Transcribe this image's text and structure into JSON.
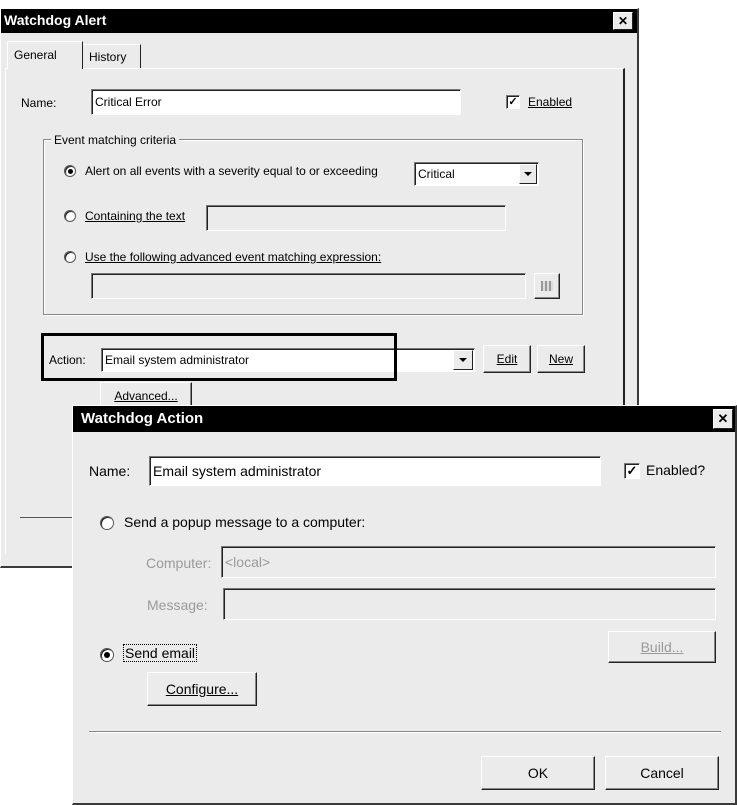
{
  "alert": {
    "title": "Watchdog Alert",
    "close_glyph": "✕",
    "tabs": {
      "general": "General",
      "history": "History"
    },
    "name_label": "Name:",
    "name_value": "Critical Error",
    "enabled_label": "Enabled",
    "enabled_checked": true,
    "criteria_title": "Event matching criteria",
    "option_severity_label": "Alert on all events with a severity equal to or exceeding",
    "severity_value": "Critical",
    "option_text_label": "Containing the text",
    "option_text_value": "",
    "option_expression_label": "Use the following advanced event matching expression:",
    "expression_value": "",
    "action_label": "Action:",
    "action_value": "Email system administrator",
    "edit_button": "Edit",
    "new_button": "New",
    "advanced_button": "Advanced..."
  },
  "action_dialog": {
    "title": "Watchdog Action",
    "close_glyph": "✕",
    "name_label": "Name:",
    "name_value": "Email system administrator",
    "enabled_label": "Enabled?",
    "enabled_checked": true,
    "popup_label": "Send a popup message to a computer:",
    "computer_label": "Computer:",
    "computer_value": "<local>",
    "message_label": "Message:",
    "message_value": "",
    "build_button": "Build...",
    "email_label": "Send email",
    "configure_button": "Configure...",
    "ok_button": "OK",
    "cancel_button": "Cancel"
  },
  "colors": {
    "dialog_bg": "#ebebeb",
    "titlebar": "#000000",
    "highlight_box": "#000000"
  }
}
